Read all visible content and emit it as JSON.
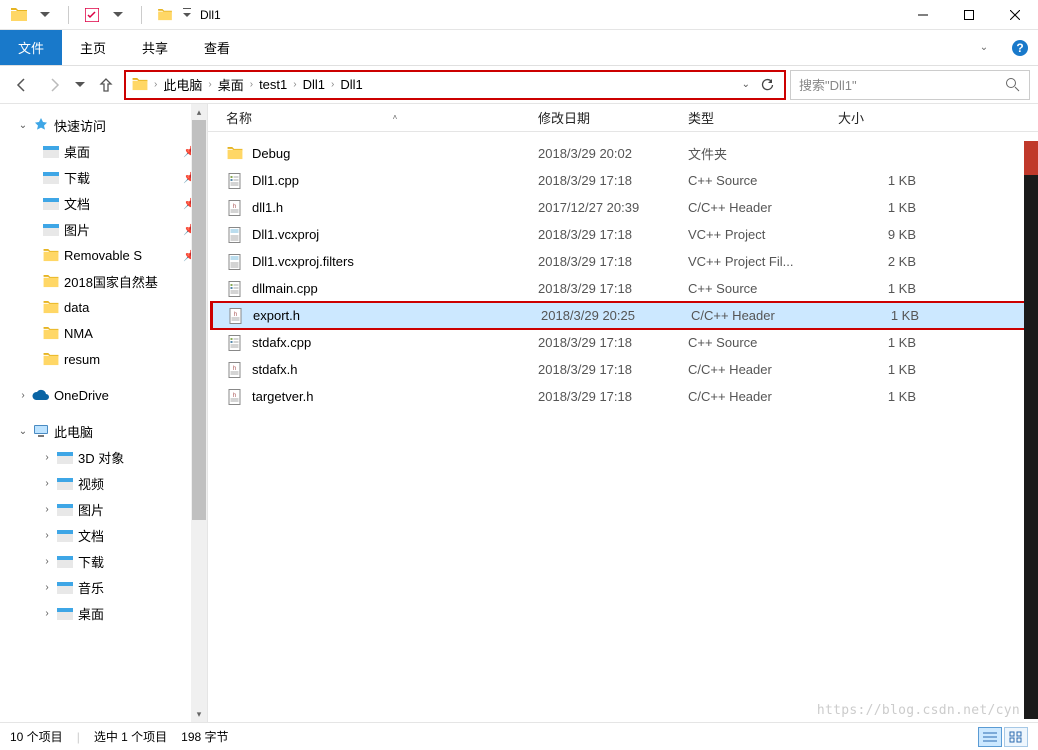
{
  "titlebar": {
    "title": "Dll1"
  },
  "ribbon": {
    "file": "文件",
    "home": "主页",
    "share": "共享",
    "view": "查看"
  },
  "breadcrumb": {
    "parts": [
      "此电脑",
      "桌面",
      "test1",
      "Dll1",
      "Dll1"
    ]
  },
  "search": {
    "placeholder": "搜索\"Dll1\""
  },
  "sidebar": {
    "quickaccess": "快速访问",
    "items_pin": [
      {
        "label": "桌面"
      },
      {
        "label": "下载"
      },
      {
        "label": "文档"
      },
      {
        "label": "图片"
      },
      {
        "label": "Removable S"
      }
    ],
    "items_nopin": [
      {
        "label": "2018国家自然基"
      },
      {
        "label": "data"
      },
      {
        "label": "NMA"
      },
      {
        "label": "resum"
      }
    ],
    "onedrive": "OneDrive",
    "thispc": "此电脑",
    "pc_items": [
      {
        "label": "3D 对象"
      },
      {
        "label": "视频"
      },
      {
        "label": "图片"
      },
      {
        "label": "文档"
      },
      {
        "label": "下载"
      },
      {
        "label": "音乐"
      },
      {
        "label": "桌面"
      }
    ]
  },
  "columns": {
    "name": "名称",
    "date": "修改日期",
    "type": "类型",
    "size": "大小"
  },
  "files": [
    {
      "name": "Debug",
      "date": "2018/3/29 20:02",
      "type": "文件夹",
      "size": "",
      "icon": "folder"
    },
    {
      "name": "Dll1.cpp",
      "date": "2018/3/29 17:18",
      "type": "C++ Source",
      "size": "1 KB",
      "icon": "cpp"
    },
    {
      "name": "dll1.h",
      "date": "2017/12/27 20:39",
      "type": "C/C++ Header",
      "size": "1 KB",
      "icon": "h"
    },
    {
      "name": "Dll1.vcxproj",
      "date": "2018/3/29 17:18",
      "type": "VC++ Project",
      "size": "9 KB",
      "icon": "proj"
    },
    {
      "name": "Dll1.vcxproj.filters",
      "date": "2018/3/29 17:18",
      "type": "VC++ Project Fil...",
      "size": "2 KB",
      "icon": "proj"
    },
    {
      "name": "dllmain.cpp",
      "date": "2018/3/29 17:18",
      "type": "C++ Source",
      "size": "1 KB",
      "icon": "cpp"
    },
    {
      "name": "export.h",
      "date": "2018/3/29 20:25",
      "type": "C/C++ Header",
      "size": "1 KB",
      "icon": "h",
      "selected": true
    },
    {
      "name": "stdafx.cpp",
      "date": "2018/3/29 17:18",
      "type": "C++ Source",
      "size": "1 KB",
      "icon": "cpp"
    },
    {
      "name": "stdafx.h",
      "date": "2018/3/29 17:18",
      "type": "C/C++ Header",
      "size": "1 KB",
      "icon": "h"
    },
    {
      "name": "targetver.h",
      "date": "2018/3/29 17:18",
      "type": "C/C++ Header",
      "size": "1 KB",
      "icon": "h"
    }
  ],
  "status": {
    "count": "10 个项目",
    "selected": "选中 1 个项目",
    "bytes": "198 字节"
  },
  "watermark": "https://blog.csdn.net/cyn"
}
